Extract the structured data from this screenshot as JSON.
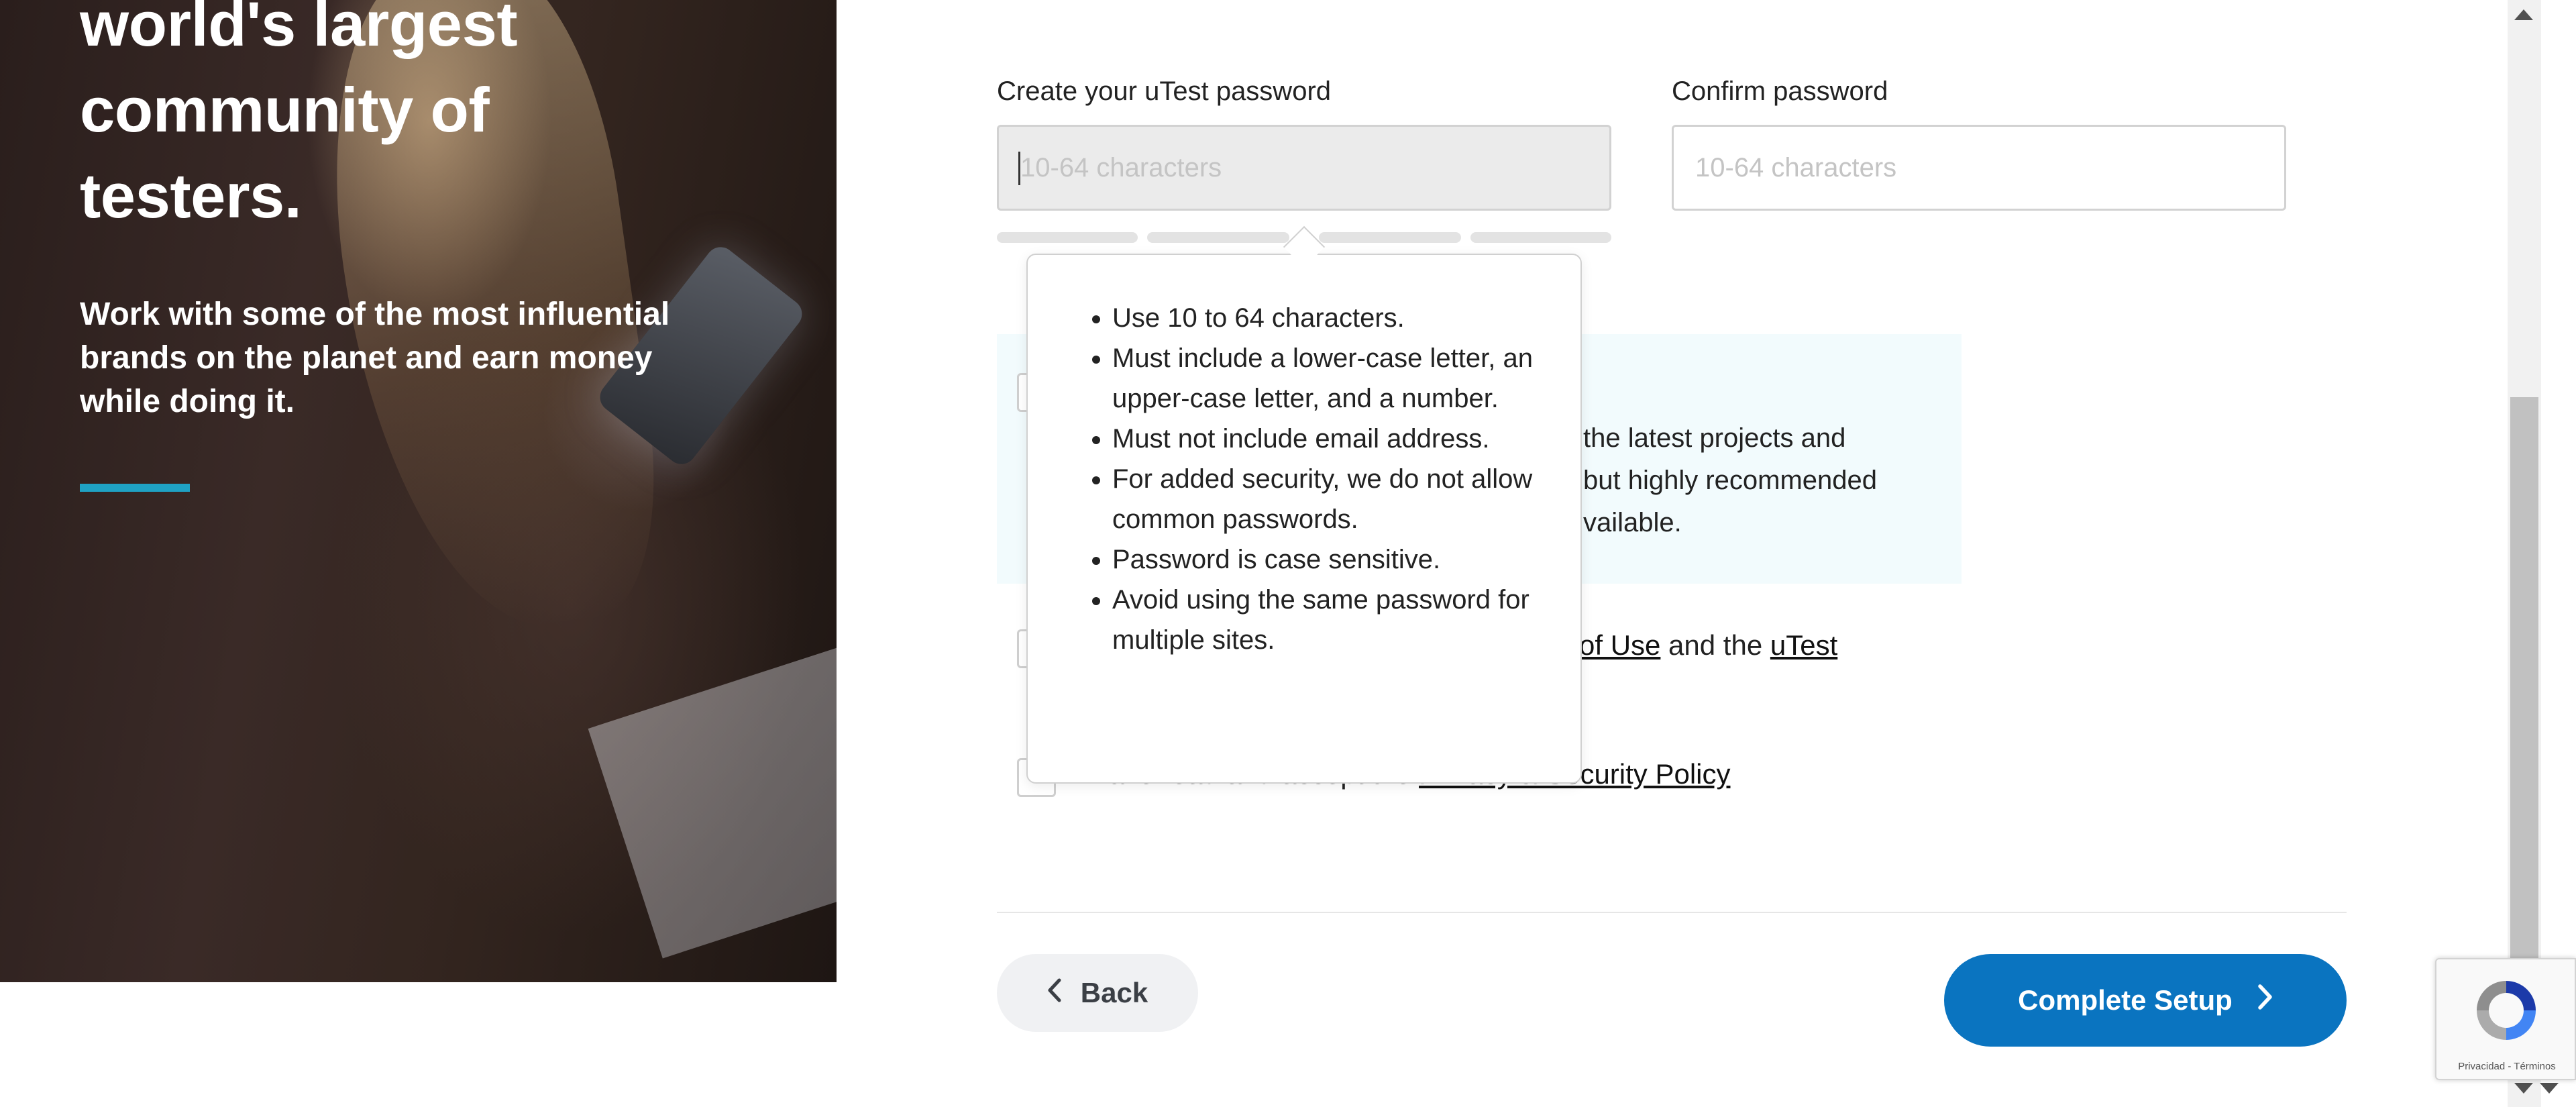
{
  "hero": {
    "headline_lines": [
      "world's largest",
      "community of",
      "testers."
    ],
    "subtext": "Work with some of the most influential brands on the planet and earn money while doing it.",
    "accent_color": "#1fa2c4"
  },
  "form": {
    "password_label": "Create your uTest password",
    "password_placeholder": "10-64 characters",
    "password_value": "",
    "confirm_label": "Confirm password",
    "confirm_placeholder": "10-64 characters",
    "confirm_value": "",
    "strength_segments_filled": 0,
    "strength_segments_total": 4,
    "notice_lines": [
      "the latest projects and",
      "but highly recommended",
      "vailable."
    ],
    "terms_fragment": {
      "link1": "of Use",
      "middle": " and the ",
      "link2": "uTest"
    },
    "privacy": {
      "prefix": "I have read and accept the ",
      "link": "Privacy & Security Policy"
    }
  },
  "tooltip": {
    "rules": [
      "Use 10 to 64 characters.",
      "Must include a lower-case letter, an upper-case letter, and a number.",
      "Must not include email address.",
      "For added security, we do not allow common passwords.",
      "Password is case sensitive.",
      "Avoid using the same password for multiple sites."
    ]
  },
  "footer": {
    "back_label": "Back",
    "complete_label": "Complete Setup",
    "primary_color": "#0a74c0"
  },
  "recaptcha": {
    "text": "Privacidad - Términos"
  },
  "icons": {
    "back": "chevron-left-icon",
    "complete": "chevron-right-icon",
    "recaptcha": "recaptcha-logo-icon"
  }
}
